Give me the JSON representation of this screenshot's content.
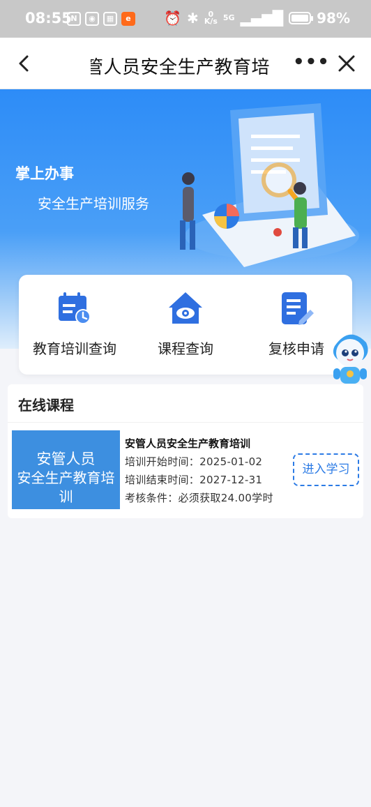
{
  "status_bar": {
    "time": "08:55",
    "net_speed_top": "0",
    "net_speed_bottom": "K/s",
    "network": "5G",
    "battery": "98%",
    "battery_level": 0.98
  },
  "navbar": {
    "title": "管人员安全生产教育培",
    "more_label": "•••"
  },
  "banner": {
    "title": "掌上办事",
    "subtitle": "安全生产培训服务"
  },
  "menu": {
    "items": [
      {
        "label": "教育培训查询",
        "icon": "calendar-clock-icon"
      },
      {
        "label": "课程查询",
        "icon": "eye-house-icon"
      },
      {
        "label": "复核申请",
        "icon": "document-edit-icon"
      }
    ]
  },
  "courses": {
    "section_title": "在线课程",
    "items": [
      {
        "thumb_line1": "安管人员",
        "thumb_line2": "安全生产教育培训",
        "name": "安管人员安全生产教育培训",
        "start": "培训开始时间：2025-01-02",
        "end": "培训结束时间：2027-12-31",
        "condition": "考核条件：必须获取24.00学时",
        "button": "进入学习"
      }
    ]
  },
  "colors": {
    "primary": "#2c7be5",
    "banner_top": "#2d8cf7",
    "thumb": "#3d8fe0"
  }
}
